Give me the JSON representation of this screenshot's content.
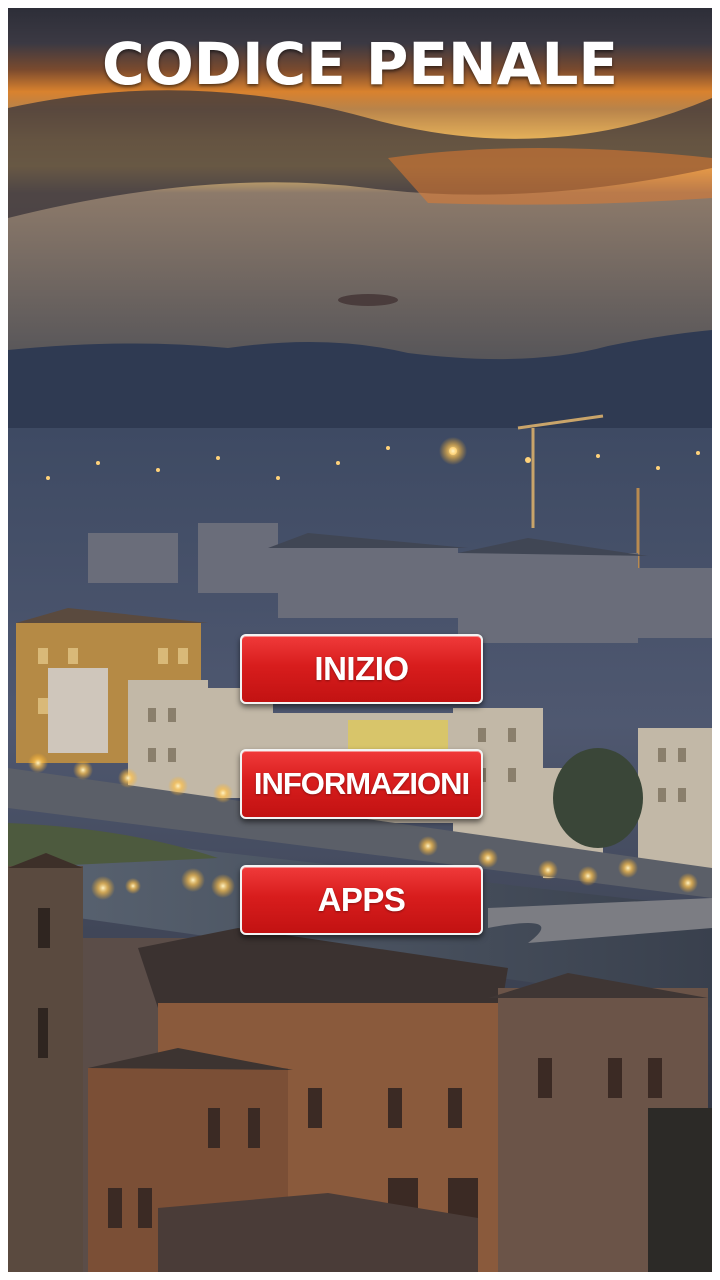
{
  "app": {
    "title": "CODICE PENALE"
  },
  "menu": {
    "buttons": [
      {
        "label": "INIZIO"
      },
      {
        "label": "INFORMAZIONI"
      },
      {
        "label": "APPS"
      }
    ]
  },
  "colors": {
    "button_red": "#d81d1d",
    "button_border": "#f3f3f3",
    "title_color": "#ffffff"
  }
}
